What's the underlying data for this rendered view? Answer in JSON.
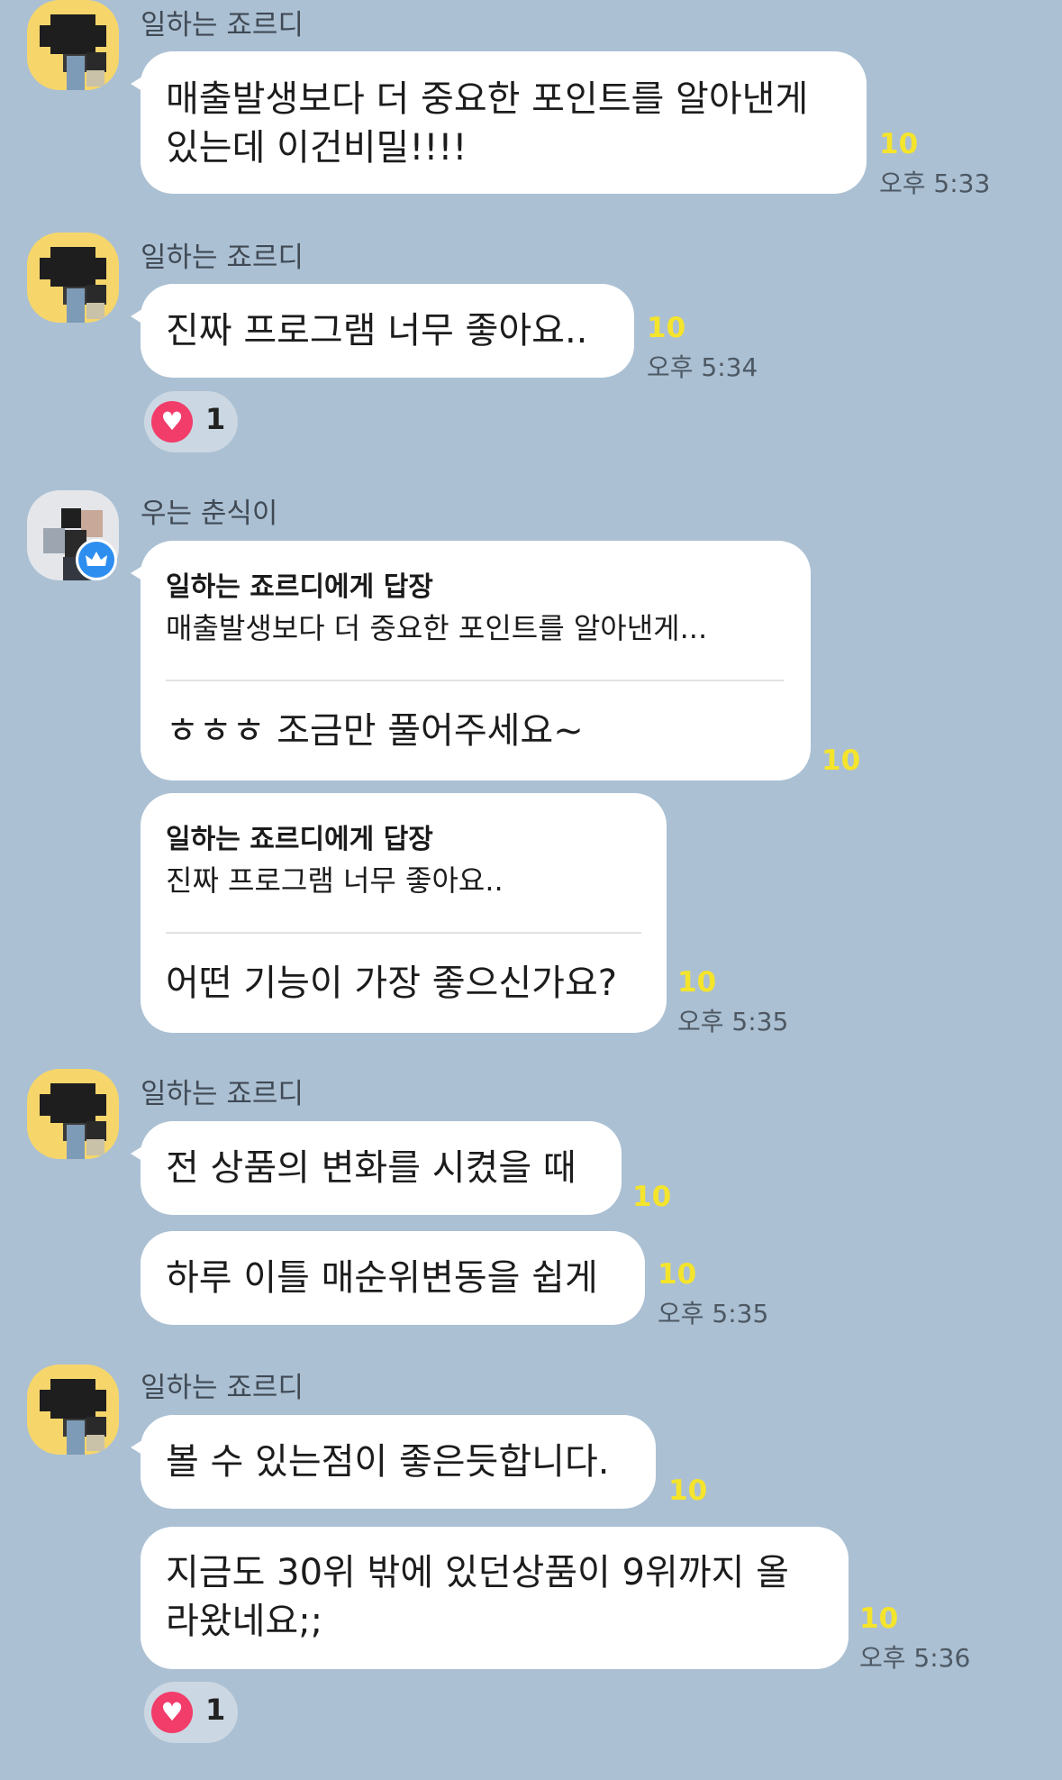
{
  "messages": [
    {
      "sender": "일하는 죠르디",
      "lines": [
        "매출발생보다 더 중요한 포인트를 알아낸게",
        "있는데 이건비밀!!!!"
      ],
      "count": "10",
      "time": "오후 5:33"
    },
    {
      "sender": "일하는 죠르디",
      "lines": [
        "진짜 프로그램 너무 좋아요.."
      ],
      "count": "10",
      "time": "오후 5:34",
      "reaction": {
        "icon": "heart-icon",
        "count": "1"
      }
    },
    {
      "sender": "우는 춘식이",
      "badge_icon": "crown-icon",
      "reply_to": "일하는 죠르디에게 답장",
      "quote": "매출발생보다 더 중요한 포인트를 알아낸게...",
      "lines": [
        "ㅎㅎㅎ 조금만 풀어주세요~"
      ],
      "count": "10"
    },
    {
      "reply_to": "일하는 죠르디에게 답장",
      "quote": "진짜 프로그램 너무 좋아요..",
      "lines": [
        "어떤 기능이 가장 좋으신가요?"
      ],
      "count": "10",
      "time": "오후 5:35"
    },
    {
      "sender": "일하는 죠르디",
      "lines": [
        "전 상품의 변화를 시켰을 때"
      ],
      "count": "10"
    },
    {
      "lines": [
        "하루 이틀 매순위변동을 쉽게"
      ],
      "count": "10",
      "time": "오후 5:35"
    },
    {
      "sender": "일하는 죠르디",
      "lines": [
        "볼 수 있는점이 좋은듯합니다."
      ],
      "count": "10"
    },
    {
      "lines": [
        "지금도 30위 밖에 있던상품이 9위까지 올",
        "라왔네요;;"
      ],
      "count": "10",
      "time": "오후 5:36",
      "reaction": {
        "icon": "heart-icon",
        "count": "1"
      }
    }
  ],
  "colors": {
    "background": "#abc0d3",
    "bubble": "#ffffff",
    "unread_count": "#f5e42c",
    "heart": "#f23c6a",
    "crown_badge": "#2e8ef0"
  }
}
